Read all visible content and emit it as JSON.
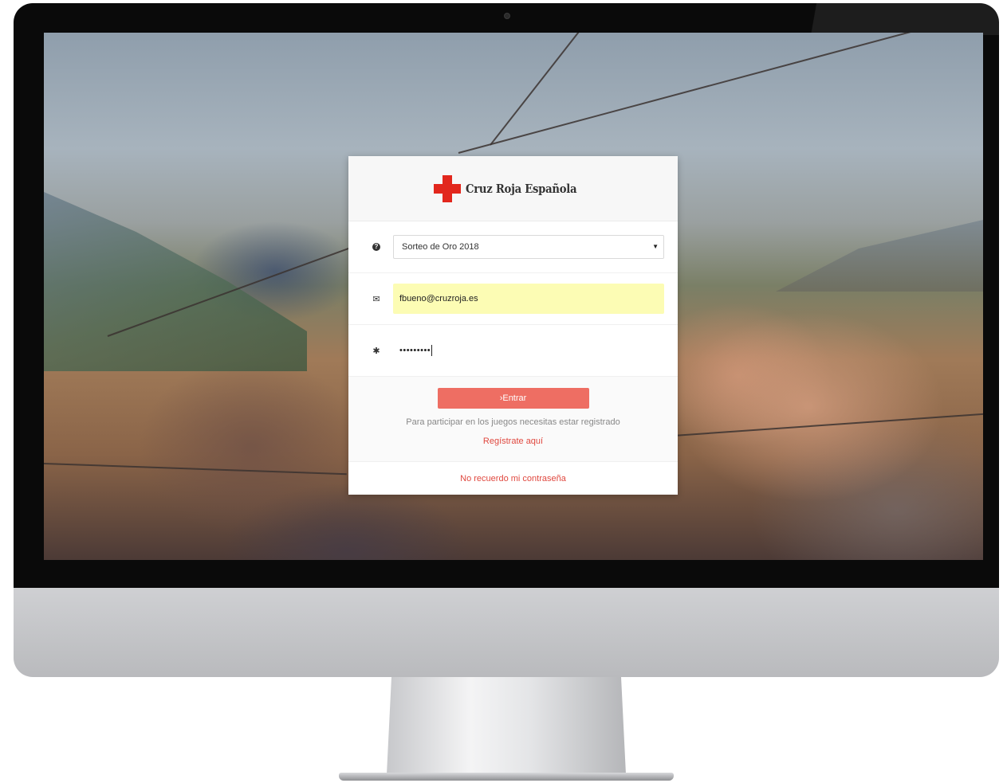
{
  "brand": {
    "name": "Cruz Roja Española",
    "logo_color": "#e2271d"
  },
  "form": {
    "game_select": {
      "icon": "question-circle-icon",
      "selected": "Sorteo de Oro 2018"
    },
    "email": {
      "icon": "envelope-icon",
      "value": "fbueno@cruzroja.es"
    },
    "password": {
      "icon": "asterisk-icon",
      "value": "•••••••••"
    },
    "submit_label": "›Entrar",
    "info_text": "Para participar en los juegos necesitas estar registrado",
    "register_link": "Regístrate aquí",
    "forgot_link": "No recuerdo mi contraseña"
  },
  "colors": {
    "accent": "#ee6e63",
    "link": "#e0483f",
    "autofill": "#fcfcb4"
  }
}
